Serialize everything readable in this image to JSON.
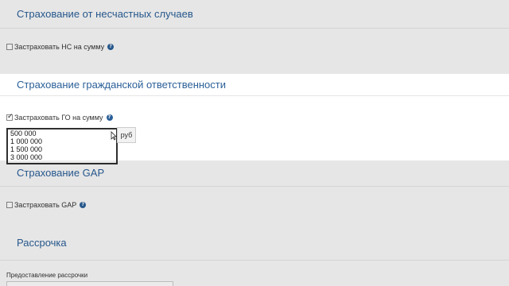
{
  "sections": {
    "accident": {
      "title": "Страхование от несчастных случаев",
      "option_label": "Застраховать НС на сумму"
    },
    "liability": {
      "title": "Страхование гражданской ответственности",
      "option_label": "Застраховать ГО на сумму"
    },
    "gap": {
      "title": "Страхование GAP",
      "option_label": "Застраховать GAP"
    },
    "installment": {
      "title": "Рассрочка",
      "field_label": "Предоставление рассрочки"
    }
  },
  "dropdown": {
    "options": [
      "500 000",
      "1 000 000",
      "1 500 000",
      "3 000 000"
    ]
  },
  "currency_suffix": "руб",
  "help_icon_text": "?"
}
